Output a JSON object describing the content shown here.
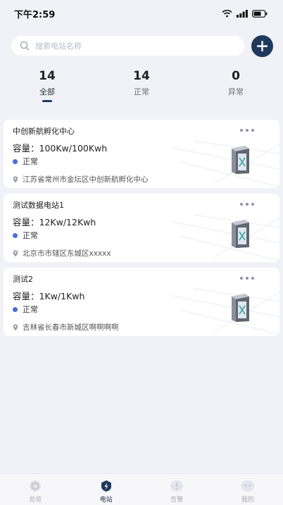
{
  "status_bar": {
    "time": "下午2:59"
  },
  "search": {
    "placeholder": "搜索电站名称"
  },
  "stats": [
    {
      "count": "14",
      "label": "全部"
    },
    {
      "count": "14",
      "label": "正常"
    },
    {
      "count": "0",
      "label": "异常"
    }
  ],
  "stations": [
    {
      "name": "中创新航孵化中心",
      "capacity": "容量：100Kw/100Kwh",
      "status": "正常",
      "address": "江苏省常州市金坛区中创新航孵化中心"
    },
    {
      "name": "测试数据电站1",
      "capacity": "容量：12Kw/12Kwh",
      "status": "正常",
      "address": "北京市市辖区东城区xxxxx"
    },
    {
      "name": "测试2",
      "capacity": "容量：1Kw/1Kwh",
      "status": "正常",
      "address": "吉林省长春市新城区啊啊啊啊"
    }
  ],
  "tabbar": [
    {
      "label": "总览",
      "icon": "overview-icon"
    },
    {
      "label": "电站",
      "icon": "station-icon"
    },
    {
      "label": "告警",
      "icon": "alarm-icon"
    },
    {
      "label": "我的",
      "icon": "profile-icon"
    }
  ],
  "colors": {
    "accent": "#1f3a5c",
    "status_dot": "#4a6ae8",
    "background": "#f1f2f7"
  }
}
